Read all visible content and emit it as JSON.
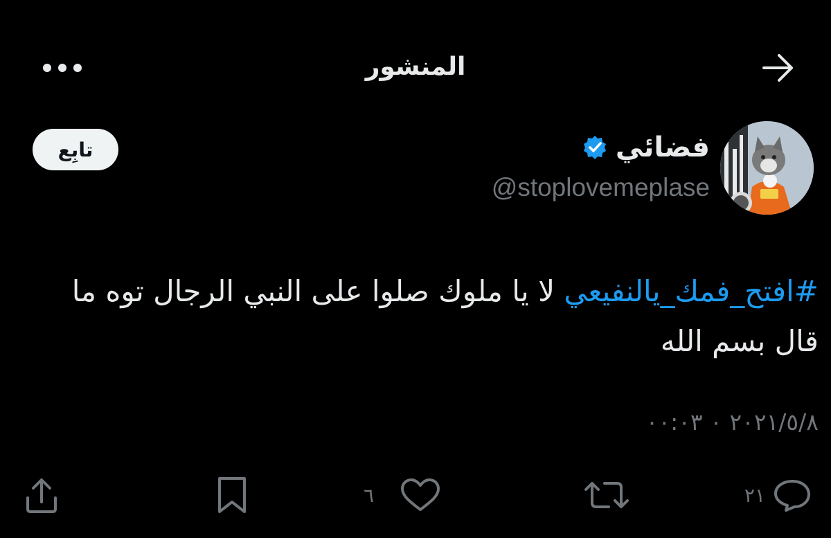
{
  "header": {
    "title": "المنشور",
    "back_icon": "arrow-right-icon",
    "more_icon": "more-horizontal-icon"
  },
  "author": {
    "display_name": "فضائي",
    "handle": "@stoplovemeplase",
    "verified": true,
    "verified_icon": "verified-badge-icon",
    "badge_color": "#1d9bf0",
    "avatar_icon": "cat-astronaut-avatar"
  },
  "follow_button": {
    "label": "تابِع"
  },
  "tweet": {
    "hashtag": "#افتح_فمك_يالنفيعي",
    "text_after_hashtag": " لا يا ملوك صلوا على النبي الرجال توه ما قال بسم الله"
  },
  "timestamp": "٢٠٢١/٥/٨ ٠ ٠٠:٠٣",
  "actions": {
    "reply": {
      "icon": "reply-icon",
      "count": "٢١"
    },
    "retweet": {
      "icon": "retweet-icon"
    },
    "like": {
      "icon": "heart-icon",
      "count": "٦"
    },
    "bookmark": {
      "icon": "bookmark-icon"
    },
    "share": {
      "icon": "share-icon"
    }
  },
  "colors": {
    "background": "#000000",
    "text": "#e7e9ea",
    "muted": "#71767b",
    "accent": "#1d9bf0"
  }
}
